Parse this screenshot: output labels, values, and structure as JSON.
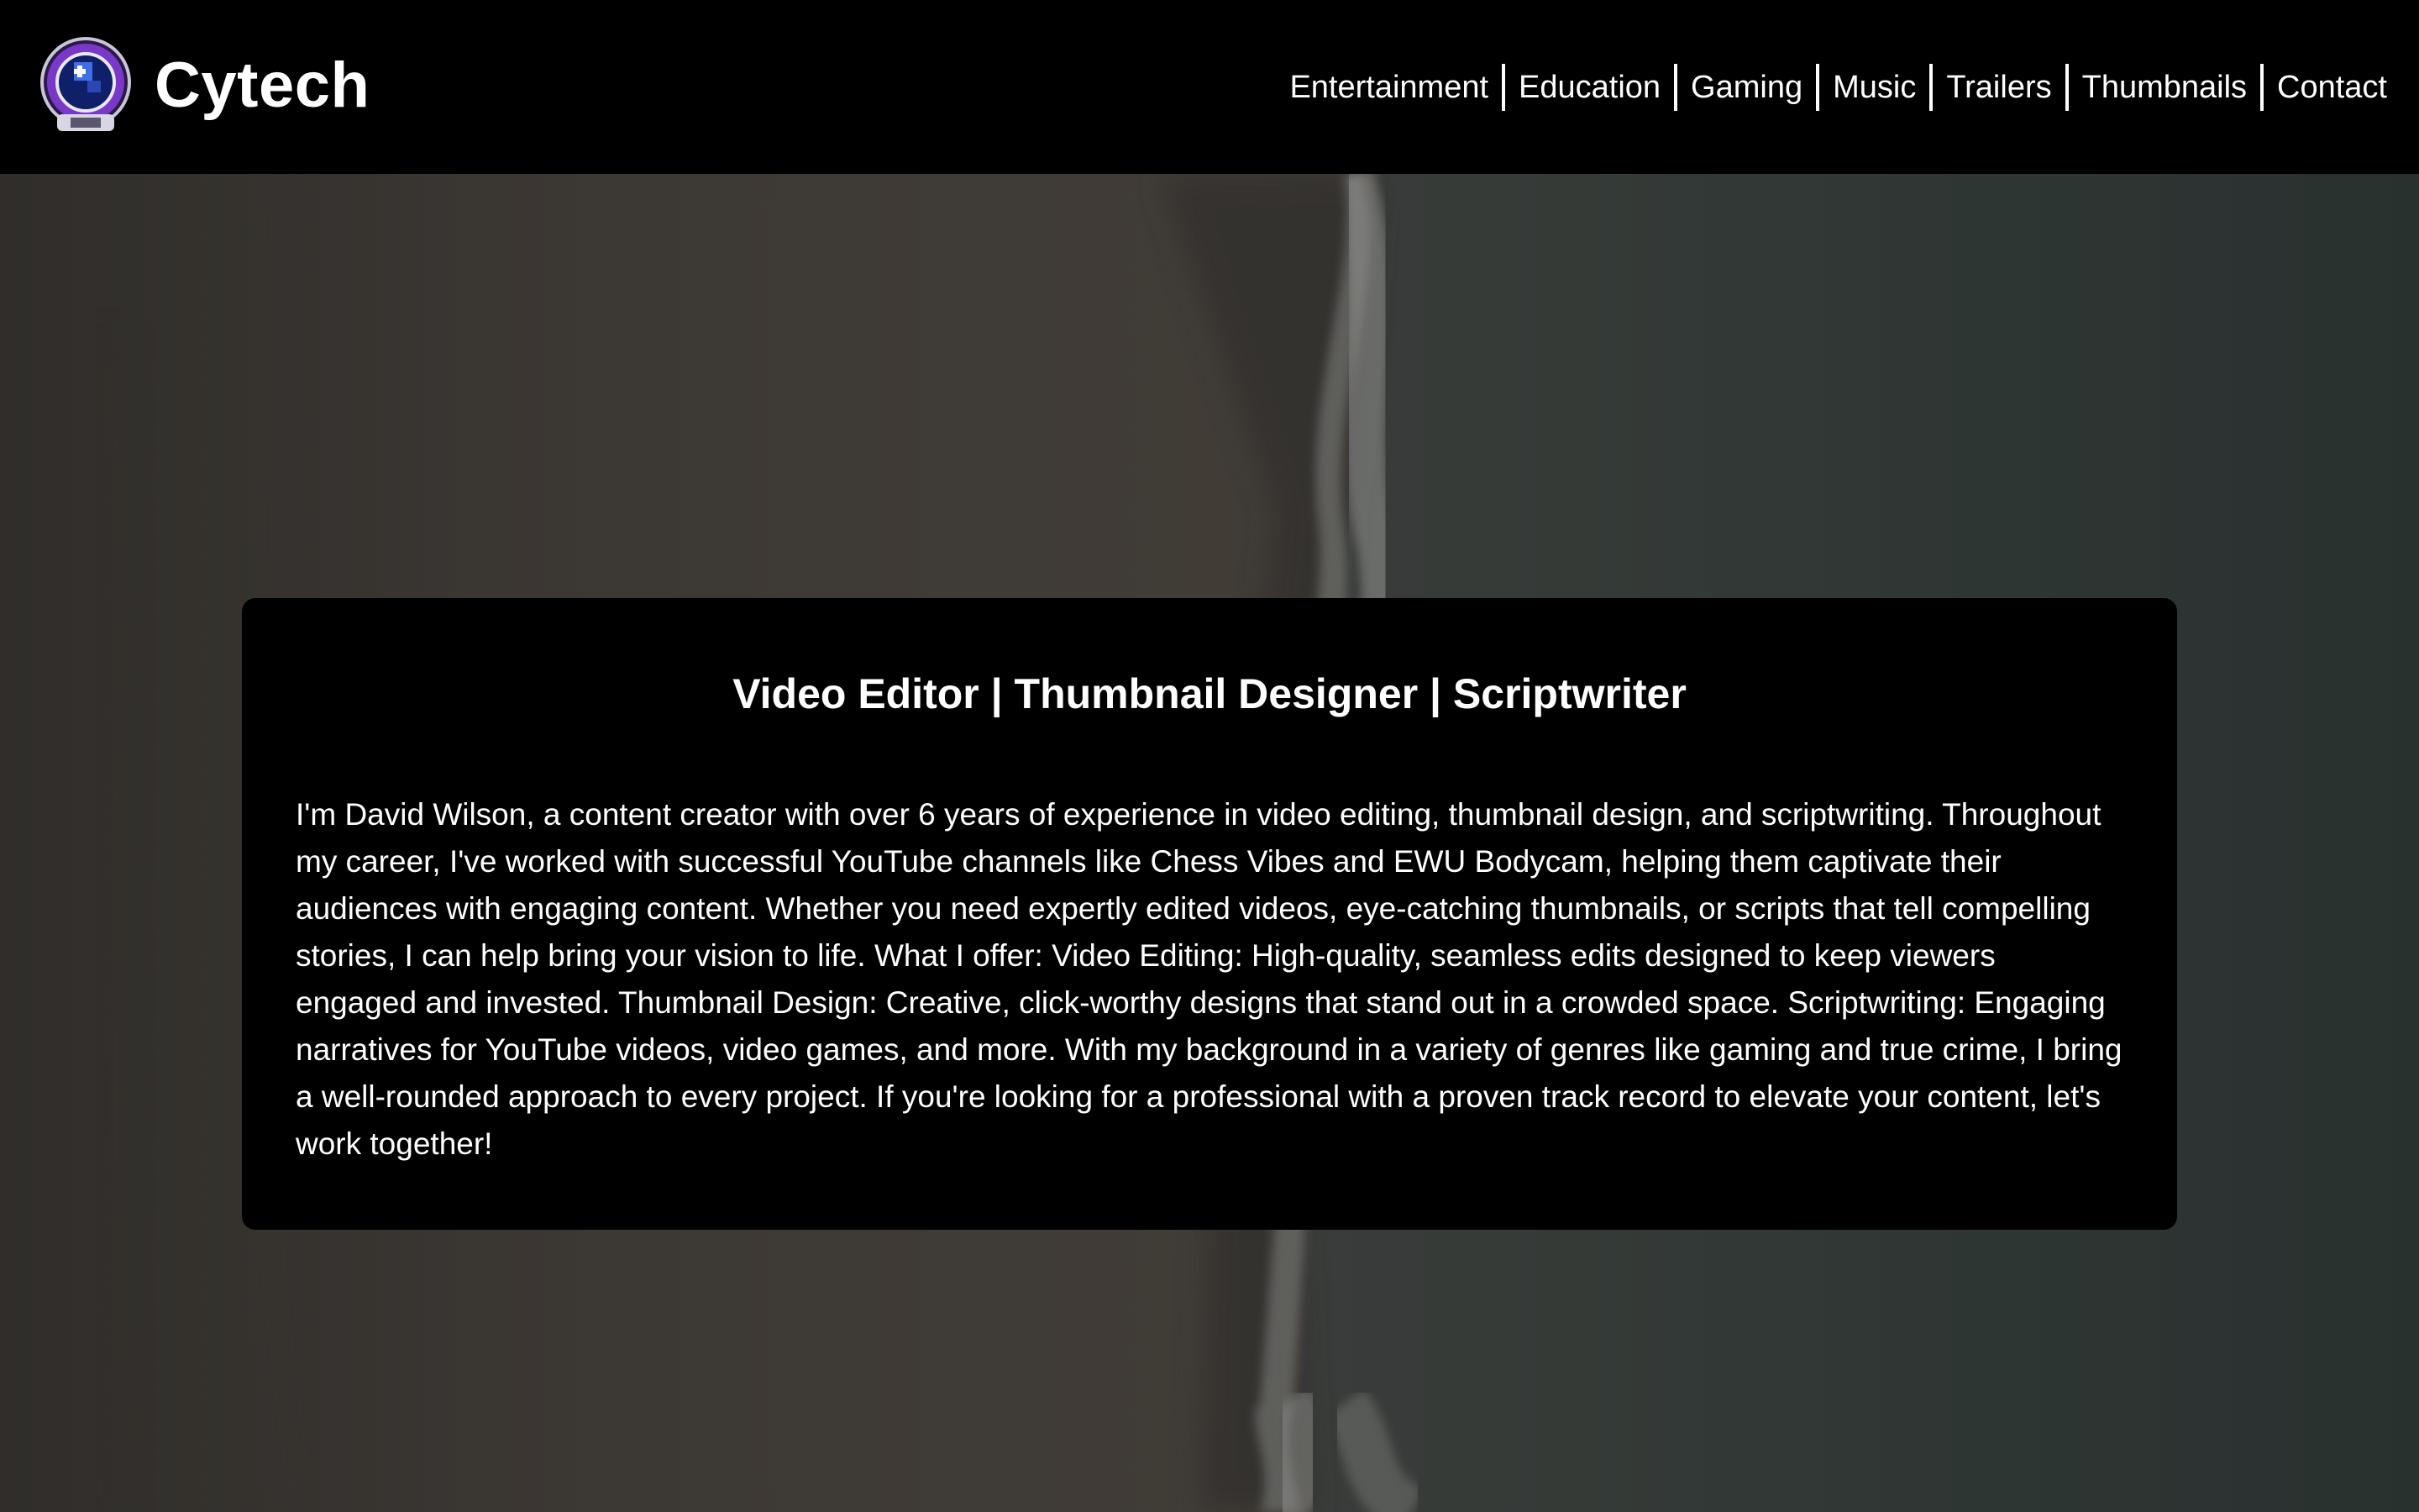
{
  "header": {
    "brand": "Cytech",
    "logo_icon": "astronaut-helmet-icon",
    "nav": [
      {
        "label": "Entertainment"
      },
      {
        "label": "Education"
      },
      {
        "label": "Gaming"
      },
      {
        "label": "Music"
      },
      {
        "label": "Trailers"
      },
      {
        "label": "Thumbnails"
      },
      {
        "label": "Contact"
      }
    ]
  },
  "hero": {
    "background": "aerial-beach-video"
  },
  "card": {
    "title": "Video Editor | Thumbnail Designer | Scriptwriter",
    "body": "I'm David Wilson, a content creator with over 6 years of experience in video editing, thumbnail design, and scriptwriting. Throughout my career, I've worked with successful YouTube channels like Chess Vibes and EWU Bodycam, helping them captivate their audiences with engaging content. Whether you need expertly edited videos, eye-catching thumbnails, or scripts that tell compelling stories, I can help bring your vision to life. What I offer: Video Editing: High-quality, seamless edits designed to keep viewers engaged and invested. Thumbnail Design: Creative, click-worthy designs that stand out in a crowded space. Scriptwriting: Engaging narratives for YouTube videos, video games, and more. With my background in a variety of genres like gaming and true crime, I bring a well-rounded approach to every project. If you're looking for a professional with a proven track record to elevate your content, let's work together!"
  },
  "colors": {
    "header_bg": "#000000",
    "card_bg": "#000000",
    "text": "#ffffff",
    "sand": "#4a453e",
    "water": "#3a4340"
  }
}
